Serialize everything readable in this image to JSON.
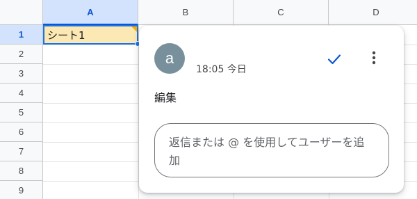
{
  "columns": [
    "A",
    "B",
    "C",
    "D"
  ],
  "rows": [
    "1",
    "2",
    "3",
    "4",
    "5",
    "6",
    "7",
    "8",
    "9"
  ],
  "cells": {
    "A1": "シート1"
  },
  "comment": {
    "avatar_letter": "a",
    "timestamp": "18:05 今日",
    "text": "編集",
    "reply_placeholder": "返信または @ を使用してユーザーを追加",
    "resolve_icon": "checkmark-icon",
    "more_icon": "more-vert-icon"
  },
  "colors": {
    "selection": "#1a73e8",
    "cell_highlight": "#fce8b2",
    "avatar": "#78909c",
    "header_active": "#d3e3fd"
  }
}
